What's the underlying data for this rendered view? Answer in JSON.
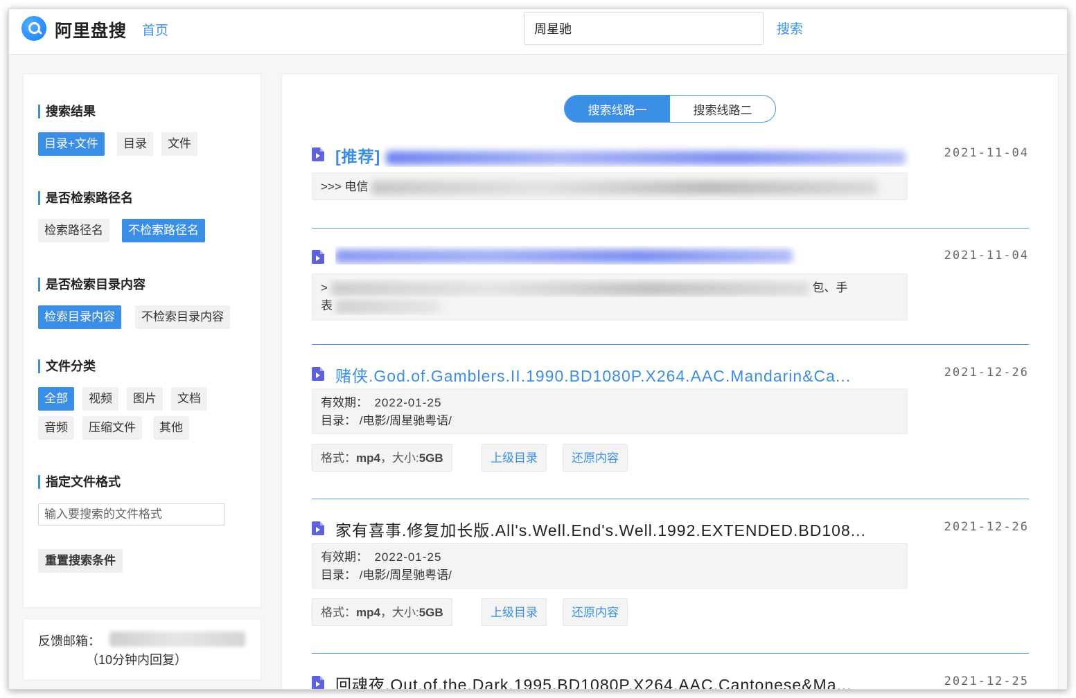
{
  "header": {
    "logo_text": "阿里盘搜",
    "home_link": "首页",
    "search_value": "周星驰",
    "search_button": "搜索"
  },
  "sidebar": {
    "search_results": {
      "title": "搜索结果",
      "options": [
        "目录+文件",
        "目录",
        "文件"
      ],
      "selected": "目录+文件"
    },
    "path_search": {
      "title": "是否检索路径名",
      "options": [
        "检索路径名",
        "不检索路径名"
      ],
      "selected": "不检索路径名"
    },
    "dir_search": {
      "title": "是否检索目录内容",
      "options": [
        "检索目录内容",
        "不检索目录内容"
      ],
      "selected": "检索目录内容"
    },
    "file_category": {
      "title": "文件分类",
      "options": [
        "全部",
        "视频",
        "图片",
        "文档",
        "音频",
        "压缩文件",
        "其他"
      ],
      "selected": "全部"
    },
    "file_format": {
      "title": "指定文件格式",
      "placeholder": "输入要搜索的文件格式"
    },
    "reset_button": "重置搜索条件"
  },
  "feedback": {
    "label": "反馈邮箱：",
    "note": "（10分钟内回复）"
  },
  "main": {
    "routes": [
      "搜索线路一",
      "搜索线路二"
    ],
    "active_route": "搜索线路一",
    "results": [
      {
        "title": "[推荐]",
        "date": "2021-11-04",
        "snippet_prefix": ">>> 电信",
        "style": "blue"
      },
      {
        "title": "",
        "date": "2021-11-04",
        "snippet_prefix": ">",
        "snippet_suffix": "包、手",
        "snippet_line2": "表",
        "style": "blue"
      },
      {
        "title": "赌侠.God.of.Gamblers.II.1990.BD1080P.X264.AAC.Mandarin&Ca...",
        "date": "2021-12-26",
        "expiry_label": "有效期：",
        "expiry": "2022-01-25",
        "dir_label": "目录：",
        "dir": "/电影/周星驰粤语/",
        "format_label": "格式：",
        "format": "mp4",
        "size_label": "，大小:",
        "size": "5GB",
        "parent_dir_button": "上级目录",
        "restore_button": "还原内容",
        "style": "blue"
      },
      {
        "title": "家有喜事.修复加长版.All's.Well.End's.Well.1992.EXTENDED.BD108...",
        "date": "2021-12-26",
        "expiry_label": "有效期：",
        "expiry": "2022-01-25",
        "dir_label": "目录：",
        "dir": "/电影/周星驰粤语/",
        "format_label": "格式：",
        "format": "mp4",
        "size_label": "，大小:",
        "size": "5GB",
        "parent_dir_button": "上级目录",
        "restore_button": "还原内容",
        "style": "dark"
      },
      {
        "title": "回魂夜.Out.of.the.Dark.1995.BD1080P.X264.AAC.Cantonese&Ma...",
        "date": "2021-12-25",
        "style": "dark"
      }
    ]
  },
  "colors": {
    "accent": "#3a8ee6",
    "file_icon": "#5f63d8"
  }
}
